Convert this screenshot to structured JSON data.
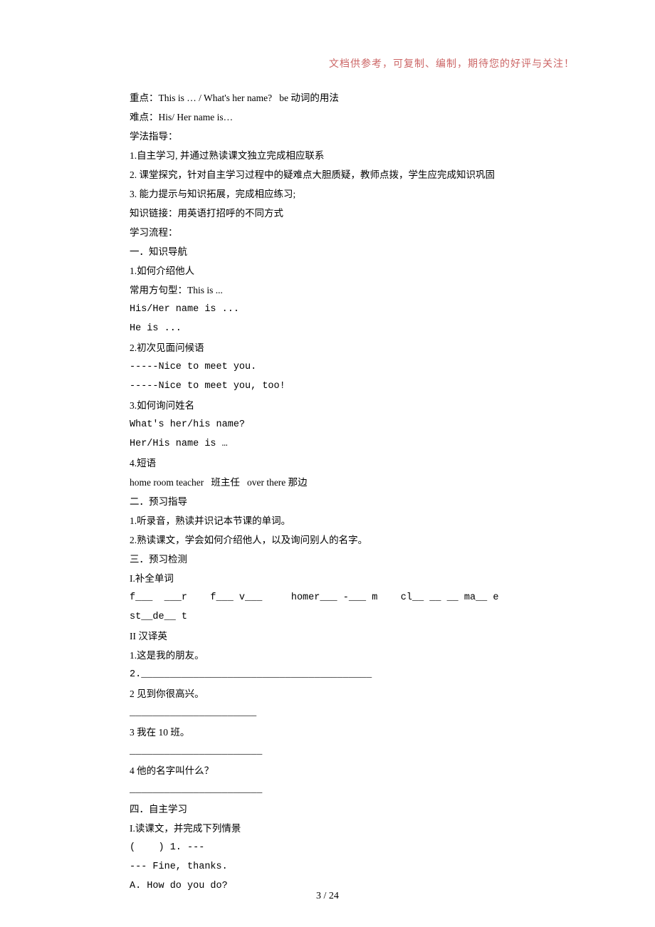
{
  "header": {
    "note": "文档供参考，可复制、编制，期待您的好评与关注！"
  },
  "lines": {
    "l01": "重点：This is … / What's her name?   be 动词的用法",
    "l02": "难点：His/ Her name is…",
    "l03": "学法指导：",
    "l04": "1.自主学习, 并通过熟读课文独立完成相应联系",
    "l05": "2. 课堂探究，针对自主学习过程中的疑难点大胆质疑，教师点拨，学生应完成知识巩固",
    "l06": "3. 能力提示与知识拓展，完成相应练习;",
    "l07": "知识链接：用英语打招呼的不同方式",
    "l08": "学习流程：",
    "l09": "一．知识导航",
    "l10": "1.如何介绍他人",
    "l11": "常用方句型：This is ...",
    "l12": "His/Her name is ...",
    "l13": "He is ...",
    "l14": "2.初次见面问候语",
    "l15": "-----Nice to meet you.",
    "l16": "-----Nice to meet you, too!",
    "l17": "3.如何询问姓名",
    "l18": "What's her/his name?",
    "l19": "Her/His name is …",
    "l20": "4.短语",
    "l21": "home room teacher   班主任   over there 那边",
    "l22": "二．预习指导",
    "l23": "1.听录音，熟读并识记本节课的单词。",
    "l24": "2.熟读课文，学会如何介绍他人，以及询问别人的名字。",
    "l25": "三．预习检测",
    "l26": "I.补全单词",
    "l27": "f___  ___r    f___ v___     homer___ -___ m    cl__ __ __ ma__ e",
    "l28": "st__de__ t",
    "l29": "II 汉译英",
    "l30": "1.这是我的朋友。",
    "l31": "2.________________________________________",
    "l32": "2 见到你很高兴。",
    "l33": "______________________",
    "l34": "3 我在 10 班。",
    "l35": "_______________________",
    "l36": "4 他的名字叫什么？",
    "l37": "_______________________",
    "l38": "四．自主学习",
    "l39": "I.读课文，并完成下列情景",
    "l40": "(    ) 1. ---",
    "l41": "--- Fine, thanks.",
    "l42": "A. How do you do?"
  },
  "footer": {
    "page": "3 / 24"
  }
}
